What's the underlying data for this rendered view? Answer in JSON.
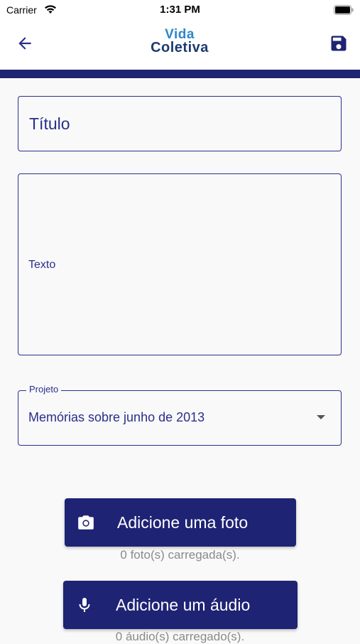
{
  "status_bar": {
    "carrier": "Carrier",
    "time": "1:31 PM"
  },
  "header": {
    "logo_line1": "Vida",
    "logo_line2": "Coletiva",
    "back_icon": "arrow-left-icon",
    "save_icon": "save-icon"
  },
  "form": {
    "title_placeholder": "Título",
    "text_placeholder": "Texto",
    "project_label": "Projeto",
    "project_value": "Memórias sobre junho de 2013"
  },
  "actions": {
    "photo_button": "Adicione uma foto",
    "photo_count": "0 foto(s) carregada(s).",
    "audio_button": "Adicione um áudio",
    "audio_count": "0 áudio(s) carregado(s)."
  },
  "colors": {
    "primary": "#1f2374",
    "accent_text": "#2a2f8a",
    "logo_light": "#2e86c8",
    "logo_dark": "#1d3a70",
    "caption": "#8a8a8a"
  }
}
